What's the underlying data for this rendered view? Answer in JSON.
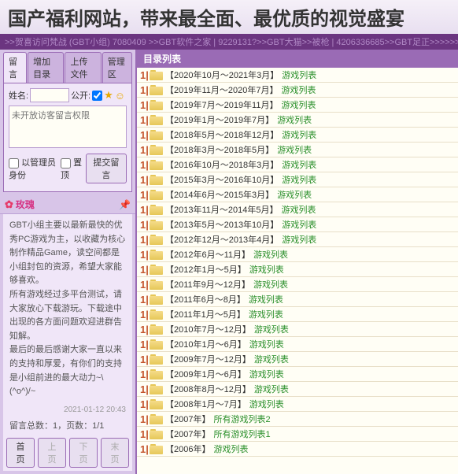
{
  "header": {
    "title": "国产福利网站，带来最全面、最优质的视觉盛宴"
  },
  "topbar": {
    "text": ">>贺喜访问梵战 (GBT小组) 7080409 >>GBT软件之家 | 9229131?>>GBT大猫>>被枪 | 4206336685>>GBT足正>>>>>>>"
  },
  "tabs": {
    "t1": "留言",
    "t2": "增加目录",
    "t3": "上传文件",
    "t4": "管理区"
  },
  "form": {
    "name_label": "姓名:",
    "public_label": "公开:",
    "textarea_placeholder": "未开放访客留言权限",
    "admin_label": "以管理员身份",
    "pin_label": "置顶",
    "submit": "提交留言"
  },
  "post": {
    "title": "玫瑰",
    "desc": "GBT小组主要以最新最快的优秀PC游戏为主，以收藏为核心制作精品Game，读空间都是小组封包的资源，希望大家能够喜欢。\n所有游戏经过多平台测试，请大家放心下载游玩。下载途中出现的各方面问题欢迎进群告知解。\n最后的最后感谢大家一直以来的支持和厚爱，有你们的支持是小组前进的最大动力~\\(^o^)/~",
    "date": "2021-01-12 20:43",
    "count_label": "留言总数：1，页数：1/1",
    "pg_first": "首页",
    "pg_prev": "上页",
    "pg_next": "下页",
    "pg_last": "末页"
  },
  "list_title": "目录列表",
  "items": [
    {
      "t": "【2020年10月～2021年3月】",
      "l": "游戏列表"
    },
    {
      "t": "【2019年11月～2020年7月】",
      "l": "游戏列表"
    },
    {
      "t": "【2019年7月～2019年11月】",
      "l": "游戏列表"
    },
    {
      "t": "【2019年1月～2019年7月】",
      "l": "游戏列表"
    },
    {
      "t": "【2018年5月～2018年12月】",
      "l": "游戏列表"
    },
    {
      "t": "【2018年3月～2018年5月】",
      "l": "游戏列表"
    },
    {
      "t": "【2016年10月～2018年3月】",
      "l": "游戏列表"
    },
    {
      "t": "【2015年3月～2016年10月】",
      "l": "游戏列表"
    },
    {
      "t": "【2014年6月～2015年3月】",
      "l": "游戏列表"
    },
    {
      "t": "【2013年11月～2014年5月】",
      "l": "游戏列表"
    },
    {
      "t": "【2013年5月～2013年10月】",
      "l": "游戏列表"
    },
    {
      "t": "【2012年12月～2013年4月】",
      "l": "游戏列表"
    },
    {
      "t": "【2012年6月～11月】",
      "l": "游戏列表"
    },
    {
      "t": "【2012年1月～5月】",
      "l": "游戏列表"
    },
    {
      "t": "【2011年9月～12月】",
      "l": "游戏列表"
    },
    {
      "t": "【2011年6月～8月】",
      "l": "游戏列表"
    },
    {
      "t": "【2011年1月～5月】",
      "l": "游戏列表"
    },
    {
      "t": "【2010年7月～12月】",
      "l": "游戏列表"
    },
    {
      "t": "【2010年1月～6月】",
      "l": "游戏列表"
    },
    {
      "t": "【2009年7月～12月】",
      "l": "游戏列表"
    },
    {
      "t": "【2009年1月～6月】",
      "l": "游戏列表"
    },
    {
      "t": "【2008年8月～12月】",
      "l": "游戏列表"
    },
    {
      "t": "【2008年1月～7月】",
      "l": "游戏列表"
    },
    {
      "t": "【2007年】",
      "l": "所有游戏列表2"
    },
    {
      "t": "【2007年】",
      "l": "所有游戏列表1"
    },
    {
      "t": "【2006年】",
      "l": "游戏列表"
    }
  ]
}
